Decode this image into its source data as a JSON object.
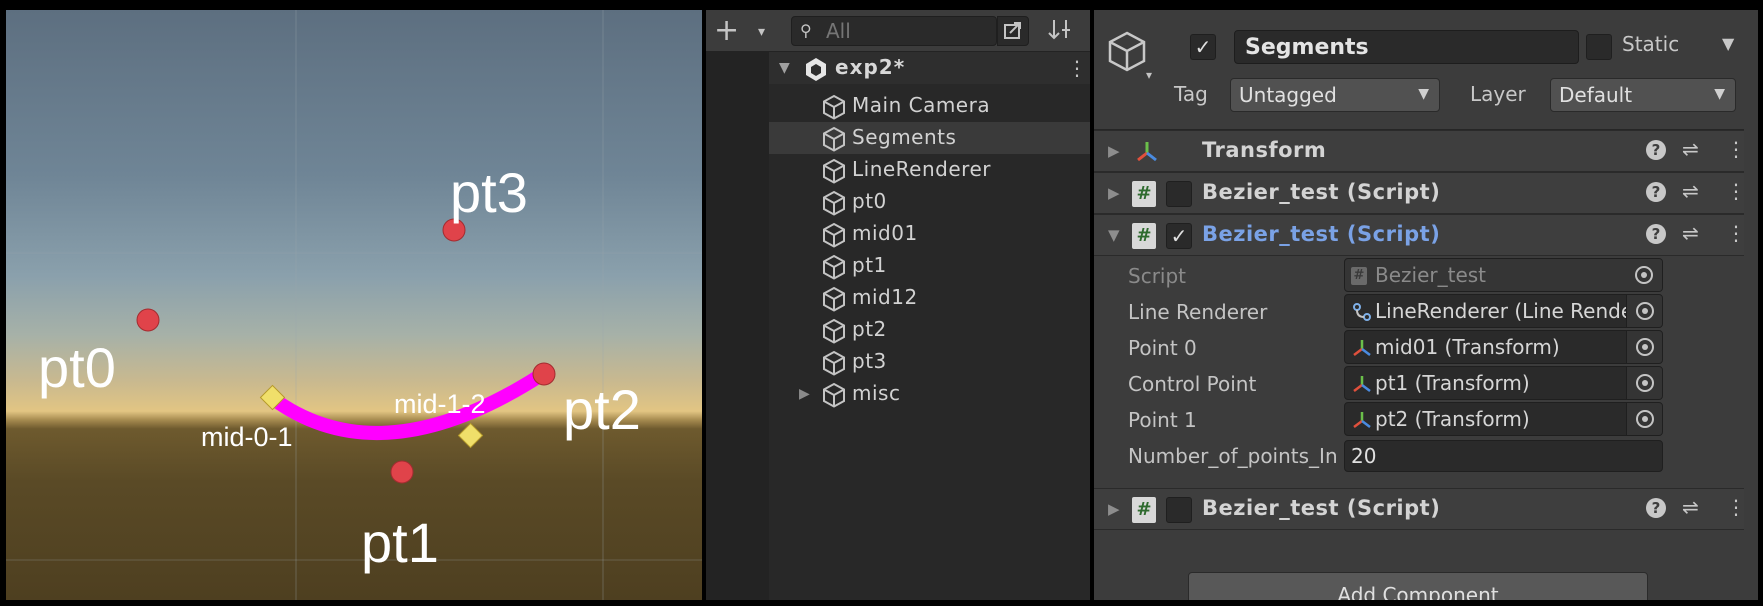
{
  "scene_view": {
    "labels": {
      "pt0": "pt0",
      "pt1": "pt1",
      "pt2": "pt2",
      "pt3": "pt3",
      "mid01": "mid-0-1",
      "mid12": "mid-1-2"
    },
    "colors": {
      "curve": "#ff00ff",
      "point": "#e0434a",
      "midpoint": "#f0df6a",
      "sky_top": "#5d6f80",
      "horizon": "#e2c583",
      "ground": "#5a4a26"
    }
  },
  "hierarchy": {
    "search_placeholder": "All",
    "scene_name": "exp2*",
    "items": [
      {
        "label": "Main Camera",
        "selected": false
      },
      {
        "label": "Segments",
        "selected": true
      },
      {
        "label": "LineRenderer",
        "selected": false
      },
      {
        "label": "pt0",
        "selected": false
      },
      {
        "label": "mid01",
        "selected": false
      },
      {
        "label": "pt1",
        "selected": false
      },
      {
        "label": "mid12",
        "selected": false
      },
      {
        "label": "pt2",
        "selected": false
      },
      {
        "label": "pt3",
        "selected": false
      },
      {
        "label": "misc",
        "selected": false,
        "collapsed": true
      }
    ]
  },
  "inspector": {
    "object_name": "Segments",
    "active": true,
    "static_label": "Static",
    "static": false,
    "tag_label": "Tag",
    "tag_value": "Untagged",
    "layer_label": "Layer",
    "layer_value": "Default",
    "components": [
      {
        "title": "Transform",
        "expanded": false
      },
      {
        "title": "Bezier_test (Script)",
        "expanded": false,
        "enabled": false
      },
      {
        "title": "Bezier_test (Script)",
        "expanded": true,
        "enabled": true
      },
      {
        "title": "Bezier_test (Script)",
        "expanded": false,
        "enabled": false
      }
    ],
    "properties": {
      "script_label": "Script",
      "script_value": "Bezier_test",
      "line_renderer_label": "Line Renderer",
      "line_renderer_value": "LineRenderer (Line Render",
      "point0_label": "Point 0",
      "point0_value": "mid01 (Transform)",
      "control_label": "Control Point",
      "control_value": "pt1 (Transform)",
      "point1_label": "Point 1",
      "point1_value": "pt2 (Transform)",
      "num_points_label": "Number_of_points_In",
      "num_points_value": "20"
    },
    "add_component_label": "Add Component",
    "icons": [
      "gameobject-cube-icon",
      "transform-axis-icon",
      "script-hash-icon",
      "help-icon",
      "presets-icon",
      "kebab-menu-icon",
      "object-picker-icon"
    ]
  }
}
